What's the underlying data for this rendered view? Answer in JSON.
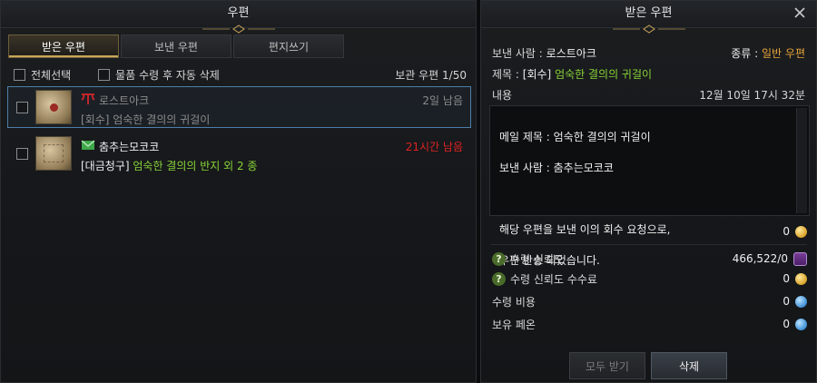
{
  "left_panel": {
    "title": "우편",
    "tabs": [
      {
        "label": "받은 우편",
        "active": true
      },
      {
        "label": "보낸 우편",
        "active": false
      },
      {
        "label": "편지쓰기",
        "active": false
      }
    ],
    "options": {
      "select_all": "전체선택",
      "auto_delete": "물품 수령 후 자동 삭제",
      "storage": "보관 우편 1/50"
    },
    "mails": [
      {
        "sender": "로스트아크",
        "prefix": "[회수]",
        "subject": "엄숙한 결의의 귀걸이",
        "time": "2일 남음",
        "icon": "lost-ark-logo-icon",
        "selected": true
      },
      {
        "sender": "춤추는모코코",
        "prefix": "[대금청구]",
        "subject": "엄숙한 결의의 반지 외 2 종",
        "time": "21시간 남음",
        "icon": "envelope-icon",
        "selected": false
      }
    ]
  },
  "right_panel": {
    "title": "받은 우편",
    "sender_label": "보낸 사람 :",
    "sender_value": "로스트아크",
    "kind_label": "종류 :",
    "kind_value": "일반 우편",
    "subject_label": "제목 :",
    "subject_prefix": "[회수]",
    "subject_value": "엄숙한 결의의 귀걸이",
    "content_label": "내용",
    "date": "12월 10일 17시 32분",
    "content_lines": [
      "메일 제목 : 엄숙한 결의의 귀걸이",
      "보낸 사람 : 춤추는모코코",
      "",
      "해당 우편을 보낸 이의 회수 요청으로,",
      "우편 반송 되었습니다."
    ],
    "gold_amount": "0",
    "stats": [
      {
        "label": "수령 신뢰도",
        "value": "466,522/0",
        "icon": "trust-icon",
        "help": true
      },
      {
        "label": "수령 신뢰도 수수료",
        "value": "0",
        "icon": "gold-coin-icon",
        "help": true
      },
      {
        "label": "수령 비용",
        "value": "0",
        "icon": "blue-coin-icon",
        "help": false
      },
      {
        "label": "보유 페온",
        "value": "0",
        "icon": "blue-coin-icon",
        "help": false
      }
    ],
    "buttons": {
      "receive_all": "모두 받기",
      "delete": "삭제"
    }
  },
  "colors": {
    "accent_gold": "#c9a65a",
    "recv_green": "#89d438",
    "time_red": "#e02323",
    "kind_orange": "#e6a33a"
  }
}
